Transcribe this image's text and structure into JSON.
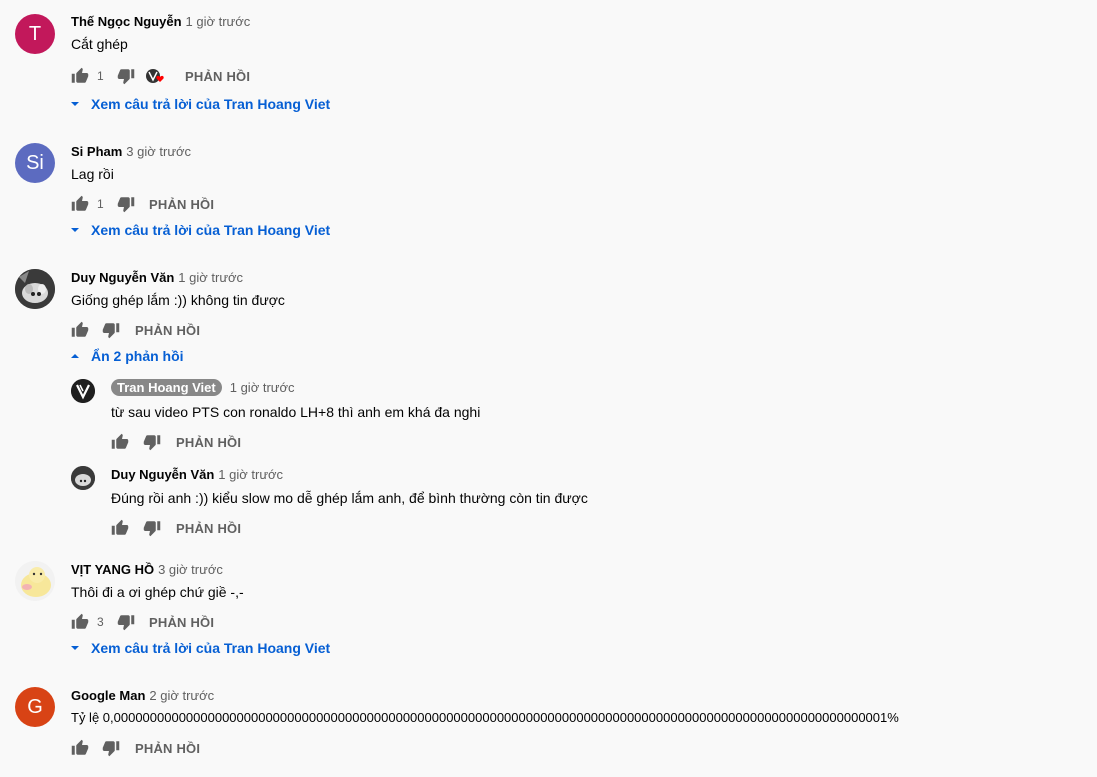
{
  "reply_label": "PHẢN HỒI",
  "comments": [
    {
      "avatar_letter": "T",
      "avatar_color": "#c2185b",
      "author": "Thế Ngọc Nguyễn",
      "time": "1 giờ trước",
      "text": "Cắt ghép",
      "likes": "1",
      "view_replies": "Xem câu trả lời của Tran Hoang Viet"
    },
    {
      "avatar_letter": "Si",
      "avatar_color": "#5c6bc0",
      "author": "Si Pham",
      "time": "3 giờ trước",
      "text": "Lag rồi",
      "likes": "1",
      "view_replies": "Xem câu trả lời của Tran Hoang Viet"
    },
    {
      "author": "Duy Nguyễn Văn",
      "time": "1 giờ trước",
      "text": "Giống ghép lắm :)) không tin được",
      "hide_replies": "Ẩn 2 phản hồi",
      "replies": [
        {
          "author": "Tran Hoang Viet",
          "time": "1 giờ trước",
          "text": "từ sau video PTS con ronaldo LH+8 thì anh em khá đa nghi"
        },
        {
          "author": "Duy Nguyễn Văn",
          "time": "1 giờ trước",
          "text": "Đúng rồi anh :)) kiểu slow mo dễ ghép lắm anh, để bình thường còn tin được"
        }
      ]
    },
    {
      "author": "VỊT YANG HỒ",
      "time": "3 giờ trước",
      "text": "Thôi đi a ơi ghép chứ giề -,-",
      "likes": "3",
      "view_replies": "Xem câu trả lời của Tran Hoang Viet"
    },
    {
      "avatar_letter": "G",
      "avatar_color": "#d84315",
      "author": "Google Man",
      "time": "2 giờ trước",
      "text": "Tỷ lệ 0,00000000000000000000000000000000000000000000000000000000000000000000000000000000000000000000000000000000001%"
    }
  ]
}
